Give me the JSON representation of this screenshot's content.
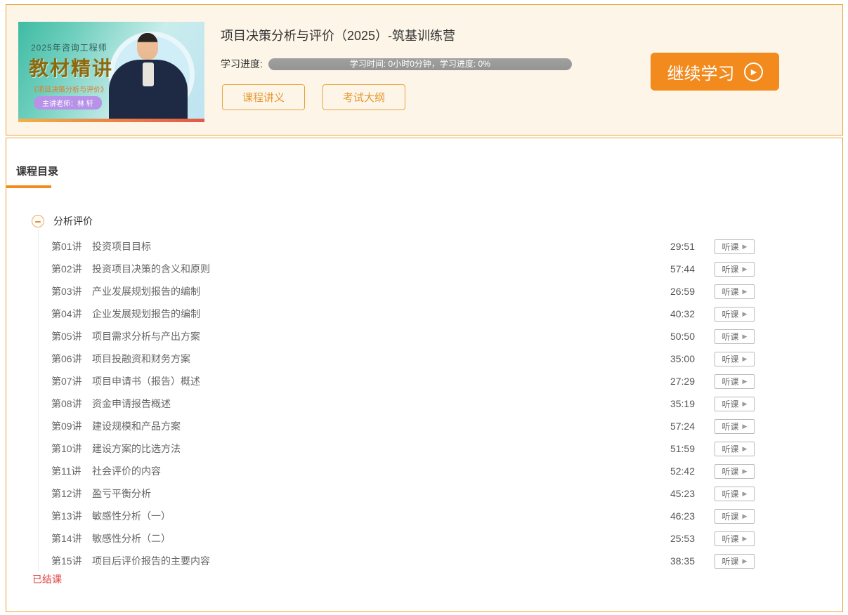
{
  "header": {
    "thumbnail": {
      "year_line": "2025年咨询工程师",
      "main_title": "教材精讲",
      "subtitle": "《项目决策分析与评价》",
      "teacher_line": "主讲老师：林 轩"
    },
    "course_title": "项目决策分析与评价（2025）-筑基训练营",
    "progress_label": "学习进度:",
    "progress_bar_text": "学习时间: 0小时0分钟，学习进度: 0%",
    "progress_percent": 0,
    "handout_button": "课程讲义",
    "syllabus_button": "考试大纲",
    "continue_button": "继续学习",
    "play_icon": "▶"
  },
  "catalog": {
    "tab_label": "课程目录",
    "section_title": "分析评价",
    "listen_button": "听课",
    "listen_icon": "▶",
    "status_text": "已结课",
    "lessons": [
      {
        "no": "第01讲",
        "title": "投资项目目标",
        "duration": "29:51"
      },
      {
        "no": "第02讲",
        "title": "投资项目决策的含义和原则",
        "duration": "57:44"
      },
      {
        "no": "第03讲",
        "title": "产业发展规划报告的编制",
        "duration": "26:59"
      },
      {
        "no": "第04讲",
        "title": "企业发展规划报告的编制",
        "duration": "40:32"
      },
      {
        "no": "第05讲",
        "title": "项目需求分析与产出方案",
        "duration": "50:50"
      },
      {
        "no": "第06讲",
        "title": "项目投融资和财务方案",
        "duration": "35:00"
      },
      {
        "no": "第07讲",
        "title": "项目申请书（报告）概述",
        "duration": "27:29"
      },
      {
        "no": "第08讲",
        "title": "资金申请报告概述",
        "duration": "35:19"
      },
      {
        "no": "第09讲",
        "title": "建设规模和产品方案",
        "duration": "57:24"
      },
      {
        "no": "第10讲",
        "title": "建设方案的比选方法",
        "duration": "51:59"
      },
      {
        "no": "第11讲",
        "title": "社会评价的内容",
        "duration": "52:42"
      },
      {
        "no": "第12讲",
        "title": "盈亏平衡分析",
        "duration": "45:23"
      },
      {
        "no": "第13讲",
        "title": "敏感性分析（一）",
        "duration": "46:23"
      },
      {
        "no": "第14讲",
        "title": "敏感性分析（二）",
        "duration": "25:53"
      },
      {
        "no": "第15讲",
        "title": "项目后评价报告的主要内容",
        "duration": "38:35"
      }
    ]
  },
  "colors": {
    "accent_orange": "#f28a1d",
    "border_orange": "#e8a33b",
    "header_bg": "#fdf6e8",
    "progress_bg": "#949494",
    "danger_red": "#e03e3e"
  }
}
